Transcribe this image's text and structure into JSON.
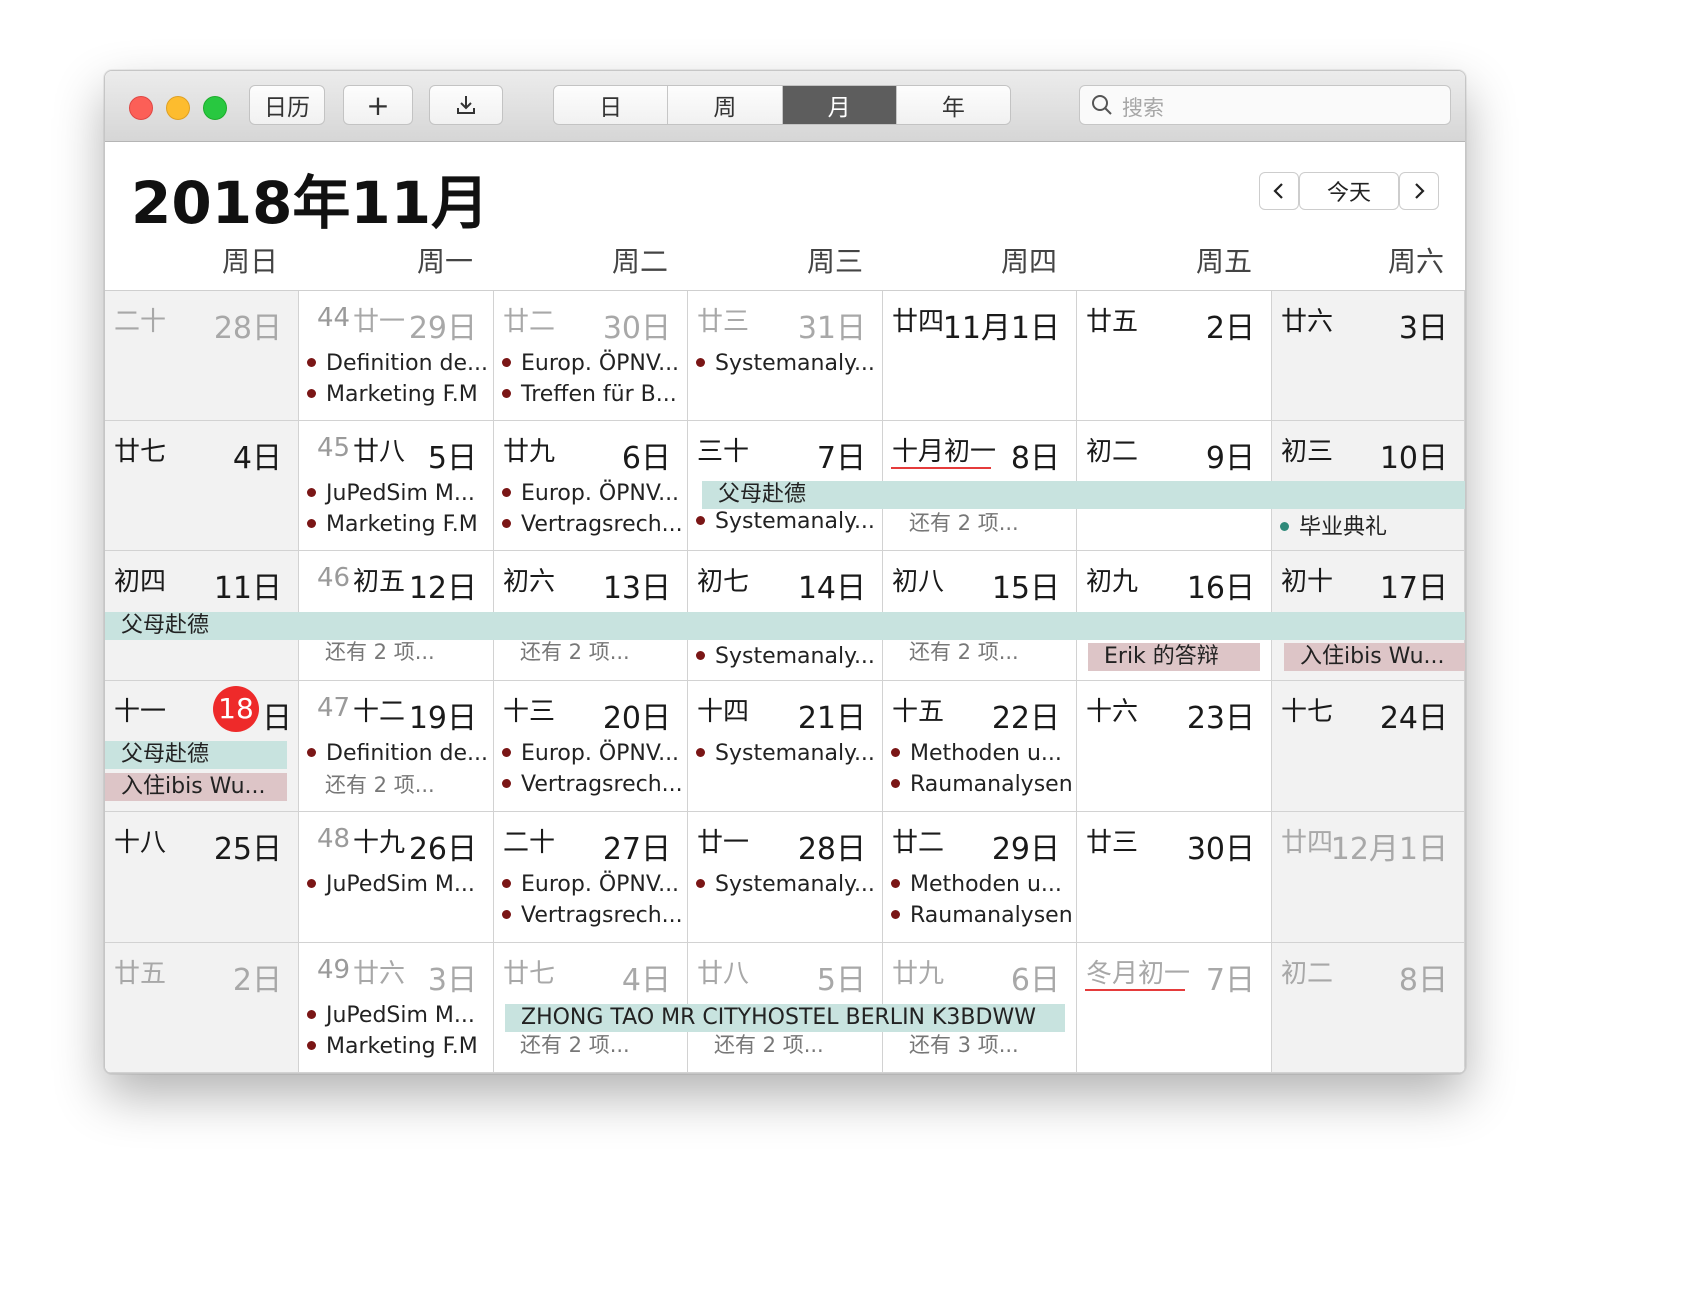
{
  "toolbar": {
    "calendars_label": "日历",
    "add_label": "+",
    "views": [
      "日",
      "周",
      "月",
      "年"
    ],
    "active_view": "月",
    "search_placeholder": "搜索"
  },
  "header": {
    "month_title": "2018年11月",
    "today_label": "今天"
  },
  "weekdays": [
    "周日",
    "周一",
    "周二",
    "周三",
    "周四",
    "周五",
    "周六"
  ],
  "weeks": [
    {
      "days": [
        {
          "lunar": "二十",
          "day": "28日",
          "dim": true
        },
        {
          "week": "44",
          "lunar": "廿一",
          "day": "29日",
          "dim": true,
          "events": [
            "Definition de...",
            "Marketing F.M"
          ]
        },
        {
          "lunar": "廿二",
          "day": "30日",
          "dim": true,
          "events": [
            "Europ. ÖPNV...",
            "Treffen für B..."
          ]
        },
        {
          "lunar": "廿三",
          "day": "31日",
          "dim": true,
          "events": [
            "Systemanaly..."
          ]
        },
        {
          "lunar": "廿四",
          "day": "11月1日"
        },
        {
          "lunar": "廿五",
          "day": "2日"
        },
        {
          "lunar": "廿六",
          "day": "3日"
        }
      ]
    },
    {
      "days": [
        {
          "lunar": "廿七",
          "day": "4日"
        },
        {
          "week": "45",
          "lunar": "廿八",
          "day": "5日",
          "events": [
            "JuPedSim M...",
            "Marketing F.M"
          ]
        },
        {
          "lunar": "廿九",
          "day": "6日",
          "events": [
            "Europ. ÖPNV...",
            "Vertragsrech..."
          ]
        },
        {
          "lunar": "三十",
          "day": "7日",
          "events2": [
            "Systemanaly..."
          ]
        },
        {
          "lunar": "十月初一",
          "day": "8日",
          "more": "还有 2 项..."
        },
        {
          "lunar": "初二",
          "day": "9日"
        },
        {
          "lunar": "初三",
          "day": "10日",
          "events2": [
            "毕业典礼"
          ]
        }
      ]
    },
    {
      "days": [
        {
          "lunar": "初四",
          "day": "11日"
        },
        {
          "week": "46",
          "lunar": "初五",
          "day": "12日",
          "more": "还有 2 项..."
        },
        {
          "lunar": "初六",
          "day": "13日",
          "more": "还有 2 项..."
        },
        {
          "lunar": "初七",
          "day": "14日",
          "events2": [
            "Systemanaly..."
          ]
        },
        {
          "lunar": "初八",
          "day": "15日",
          "more": "还有 2 项..."
        },
        {
          "lunar": "初九",
          "day": "16日"
        },
        {
          "lunar": "初十",
          "day": "17日"
        }
      ]
    },
    {
      "days": [
        {
          "lunar": "十一",
          "day": "18",
          "day_suffix": "日",
          "today": true
        },
        {
          "week": "47",
          "lunar": "十二",
          "day": "19日",
          "events": [
            "Definition de..."
          ],
          "more": "还有 2 项..."
        },
        {
          "lunar": "十三",
          "day": "20日",
          "events": [
            "Europ. ÖPNV...",
            "Vertragsrech..."
          ]
        },
        {
          "lunar": "十四",
          "day": "21日",
          "events": [
            "Systemanaly..."
          ]
        },
        {
          "lunar": "十五",
          "day": "22日",
          "events": [
            "Methoden u...",
            "Raumanalysen"
          ]
        },
        {
          "lunar": "十六",
          "day": "23日"
        },
        {
          "lunar": "十七",
          "day": "24日"
        }
      ]
    },
    {
      "days": [
        {
          "lunar": "十八",
          "day": "25日"
        },
        {
          "week": "48",
          "lunar": "十九",
          "day": "26日",
          "events": [
            "JuPedSim M..."
          ]
        },
        {
          "lunar": "二十",
          "day": "27日",
          "events": [
            "Europ. ÖPNV...",
            "Vertragsrech..."
          ]
        },
        {
          "lunar": "廿一",
          "day": "28日",
          "events": [
            "Systemanaly..."
          ]
        },
        {
          "lunar": "廿二",
          "day": "29日",
          "events": [
            "Methoden u...",
            "Raumanalysen"
          ]
        },
        {
          "lunar": "廿三",
          "day": "30日"
        },
        {
          "lunar": "廿四",
          "day": "12月1日",
          "dim": true
        }
      ]
    },
    {
      "days": [
        {
          "lunar": "廿五",
          "day": "2日",
          "dim": true
        },
        {
          "week": "49",
          "lunar": "廿六",
          "day": "3日",
          "dim": true,
          "events": [
            "JuPedSim M...",
            "Marketing F.M"
          ]
        },
        {
          "lunar": "廿七",
          "day": "4日",
          "dim": true,
          "more": "还有 2 项..."
        },
        {
          "lunar": "廿八",
          "day": "5日",
          "dim": true,
          "more": "还有 2 项..."
        },
        {
          "lunar": "廿九",
          "day": "6日",
          "dim": true,
          "more": "还有 3 项..."
        },
        {
          "lunar": "冬月初一",
          "day": "7日",
          "dim": true
        },
        {
          "lunar": "初二",
          "day": "8日",
          "dim": true
        }
      ]
    }
  ],
  "bars": {
    "parents_week2": "父母赴德",
    "parents_week3": "父母赴德",
    "erik": "Erik 的答辩",
    "ibis_week3": "入住ibis Wu...",
    "parents_week4": "父母赴德",
    "ibis_week4": "入住ibis Wu...",
    "hostel": "ZHONG TAO  MR CITYHOSTEL BERLIN K3BDWW"
  },
  "colors": {
    "today": "#ee2a2a",
    "event_dot": "#7a1616",
    "bar_teal": "#c8e3df",
    "bar_pink": "#ddc5c7"
  }
}
